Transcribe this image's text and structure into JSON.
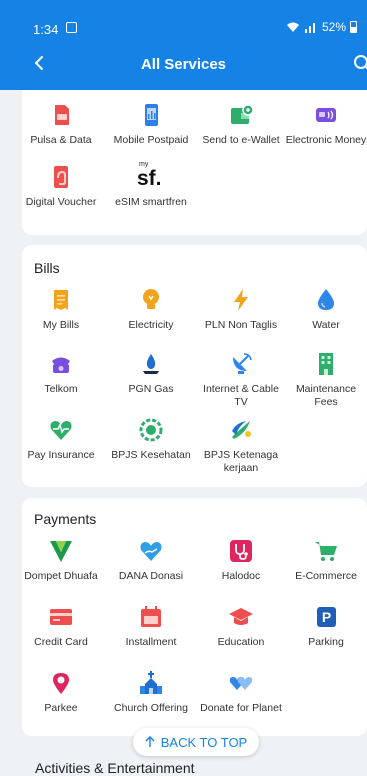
{
  "status_bar": {
    "time": "1:34",
    "battery": "52%"
  },
  "header": {
    "title": "All Services"
  },
  "top_items": [
    {
      "label": "Pulsa & Data",
      "icon": "sim-card-icon"
    },
    {
      "label": "Mobile Postpaid",
      "icon": "phone-bill-icon"
    },
    {
      "label": "Send to e-Wallet",
      "icon": "ewallet-icon"
    },
    {
      "label": "Electronic Money",
      "icon": "card-tap-icon"
    },
    {
      "label": "Digital Voucher",
      "icon": "voucher-icon"
    },
    {
      "label": "eSIM smartfren",
      "icon": "smartfren-logo",
      "logo_text": "sf.",
      "logo_small": "my"
    }
  ],
  "bills": {
    "title": "Bills",
    "items": [
      {
        "label": "My Bills",
        "icon": "receipt-icon"
      },
      {
        "label": "Electricity",
        "icon": "bulb-icon"
      },
      {
        "label": "PLN Non Taglis",
        "icon": "lightning-icon"
      },
      {
        "label": "Water",
        "icon": "water-drop-icon"
      },
      {
        "label": "Telkom",
        "icon": "telephone-icon"
      },
      {
        "label": "PGN Gas",
        "icon": "gas-flame-icon"
      },
      {
        "label": "Internet & Cable TV",
        "icon": "satellite-icon"
      },
      {
        "label": "Maintenance Fees",
        "icon": "building-icon"
      },
      {
        "label": "Pay Insurance",
        "icon": "heart-pulse-icon"
      },
      {
        "label": "BPJS Kesehatan",
        "icon": "bpjs-health-icon"
      },
      {
        "label": "BPJS Ketenaga kerjaan",
        "icon": "bpjs-employment-icon"
      }
    ]
  },
  "payments": {
    "title": "Payments",
    "items": [
      {
        "label": "Dompet Dhuafa",
        "icon": "dompet-dhuafa-icon"
      },
      {
        "label": "DANA Donasi",
        "icon": "heart-hand-icon"
      },
      {
        "label": "Halodoc",
        "icon": "stethoscope-icon"
      },
      {
        "label": "E-Commerce",
        "icon": "cart-icon"
      },
      {
        "label": "Credit Card",
        "icon": "credit-card-icon"
      },
      {
        "label": "Installment",
        "icon": "calendar-icon"
      },
      {
        "label": "Education",
        "icon": "graduation-cap-icon"
      },
      {
        "label": "Parking",
        "icon": "parking-icon",
        "glyph": "P"
      },
      {
        "label": "Parkee",
        "icon": "location-pin-icon"
      },
      {
        "label": "Church Offering",
        "icon": "church-icon"
      },
      {
        "label": "Donate for Planet",
        "icon": "hearts-icon"
      }
    ]
  },
  "back_to_top": "BACK TO TOP",
  "next_section_title": "Activities & Entertainment",
  "colors": {
    "header": "#1583e6",
    "background": "#eef1f5",
    "card": "#ffffff"
  }
}
